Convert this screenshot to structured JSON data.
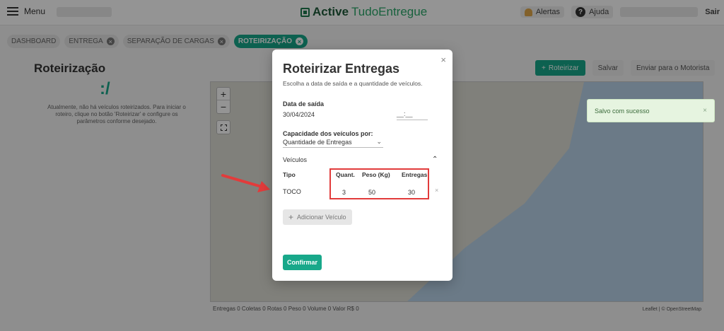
{
  "topbar": {
    "menu_label": "Menu",
    "logo_bold": "Active",
    "logo_light": "TudoEntregue",
    "alerts_label": "Alertas",
    "help_label": "Ajuda",
    "logout_label": "Sair"
  },
  "tabs": [
    {
      "label": "DASHBOARD",
      "active": false
    },
    {
      "label": "ENTREGA",
      "active": false
    },
    {
      "label": "SEPARAÇÃO DE CARGAS",
      "active": false
    },
    {
      "label": "ROTEIRIZAÇÃO",
      "active": true
    }
  ],
  "page": {
    "title": "Roteirização",
    "empty_icon": ":/",
    "empty_text": "Atualmente, não há veículos roteirizados. Para iniciar o roteiro, clique no botão 'Roteirizar' e configure os parâmetros conforme desejado."
  },
  "actions": {
    "roteirizar": "Roteirizar",
    "salvar": "Salvar",
    "enviar": "Enviar para o Motorista"
  },
  "map_footer": {
    "text": "Entregas 0 Coletas 0 Rotas 0 Peso 0 Volume 0 Valor R$ 0",
    "attribution": "Leaflet | © OpenStreetMap"
  },
  "toast": {
    "message": "Salvo com sucesso",
    "close": "×"
  },
  "modal": {
    "close": "×",
    "title": "Roteirizar Entregas",
    "subtitle": "Escolha a data de saída e a quantidade de veículos.",
    "date_label": "Data de saída",
    "date_value": "30/04/2024",
    "time_value": "__:__",
    "capacity_label": "Capacidade dos veículos por:",
    "capacity_value": "Quantidade de Entregas",
    "vehicles_label": "Veículos",
    "table": {
      "headers": {
        "tipo": "Tipo",
        "quant": "Quant.",
        "peso": "Peso (Kg)",
        "entregas": "Entregas"
      },
      "rows": [
        {
          "tipo": "TOCO",
          "quant": "3",
          "peso": "50",
          "entregas": "30"
        }
      ]
    },
    "add_vehicle": "Adicionar Veículo",
    "confirm": "Confirmar"
  },
  "colors": {
    "accent": "#18a88a",
    "highlight": "#e23b3b",
    "toast_bg": "#e6f4e0"
  }
}
